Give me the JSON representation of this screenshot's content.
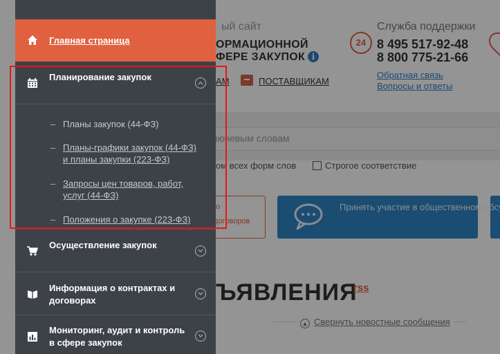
{
  "header": {
    "site_label": "ый сайт",
    "site_line1": "ОРМАЦИОННОЙ",
    "site_line2": "ФЕРЕ ЗАКУПОК",
    "info_icon": "i",
    "support_title": "Служба поддержки",
    "clock_badge": "24",
    "phone1": "8 495 517-92-48",
    "phone2": "8 800 775-21-66",
    "feedback_link": "Обратная связь",
    "faq_link": "Вопросы и ответы"
  },
  "nav": {
    "partial_link": "АМ",
    "suppliers_link": "ПОСТАВЩИКАМ"
  },
  "search": {
    "placeholder_fragment": "ключевым словам",
    "option_all_forms": "ом всех форм слов",
    "option_strict": "Строгое соответствие"
  },
  "cards": {
    "orange_top": "о",
    "orange_text": "/договоров",
    "blue_text": "Принять участие в общественном обсуждении миллиардных закупок"
  },
  "announcements": {
    "title": "БЪЯВЛЕНИЯ",
    "rss": "rss",
    "collapse_news": "Свернуть новостные сообщения"
  },
  "sidebar": {
    "home": "Главная страница",
    "planning": "Планирование закупок",
    "planning_subitems": [
      "Планы закупок (44-ФЗ)",
      "Планы-графики закупок (44-ФЗ) и планы закупки (223-ФЗ)",
      "Запросы цен товаров, работ, услуг (44-ФЗ)",
      "Положения о закупке (223-ФЗ)"
    ],
    "dash": "–",
    "execution": "Осуществление закупок",
    "contracts": "Информация о контрактах и договорах",
    "monitoring": "Мониторинг, аудит и контроль в сфере закупок"
  },
  "colors": {
    "sidebar_bg": "#3d4248",
    "accent_orange": "#e0603f",
    "highlight_red": "#e8141b",
    "link_blue": "#2f7fc1"
  },
  "icons": {
    "home": "home-icon",
    "planning": "calendar-icon",
    "execution": "cart-icon",
    "contracts": "book-icon",
    "monitoring": "chart-icon"
  }
}
